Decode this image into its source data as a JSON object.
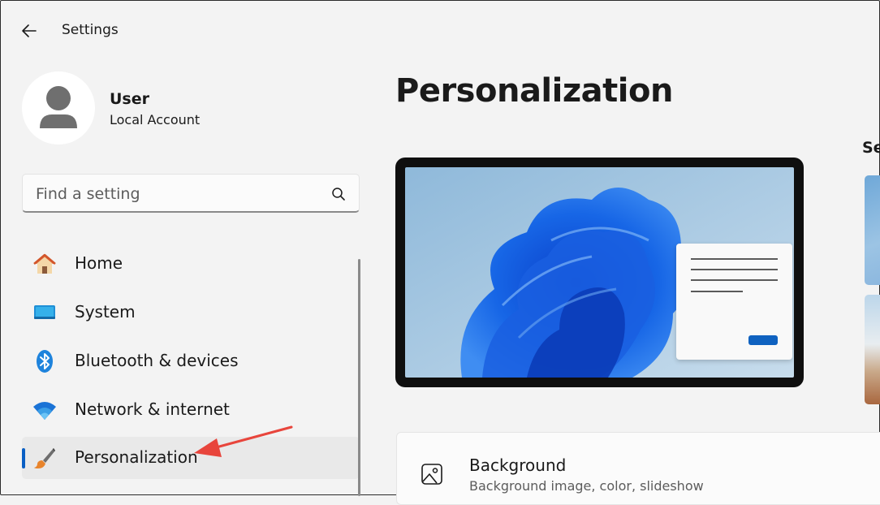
{
  "window": {
    "title": "Settings"
  },
  "user": {
    "name": "User",
    "account_type": "Local Account"
  },
  "search": {
    "placeholder": "Find a setting",
    "value": ""
  },
  "nav": {
    "items": [
      {
        "label": "Home",
        "icon": "home-icon"
      },
      {
        "label": "System",
        "icon": "system-icon"
      },
      {
        "label": "Bluetooth & devices",
        "icon": "bluetooth-icon"
      },
      {
        "label": "Network & internet",
        "icon": "wifi-icon"
      },
      {
        "label": "Personalization",
        "icon": "paintbrush-icon",
        "selected": true
      }
    ]
  },
  "main": {
    "title": "Personalization",
    "themes_heading": "Se",
    "background_card": {
      "title": "Background",
      "subtitle": "Background image, color, slideshow",
      "icon": "image-icon"
    }
  },
  "colors": {
    "accent": "#0a5fc4",
    "annotation_arrow": "#e8453c",
    "window_bg": "#f3f3f3"
  }
}
